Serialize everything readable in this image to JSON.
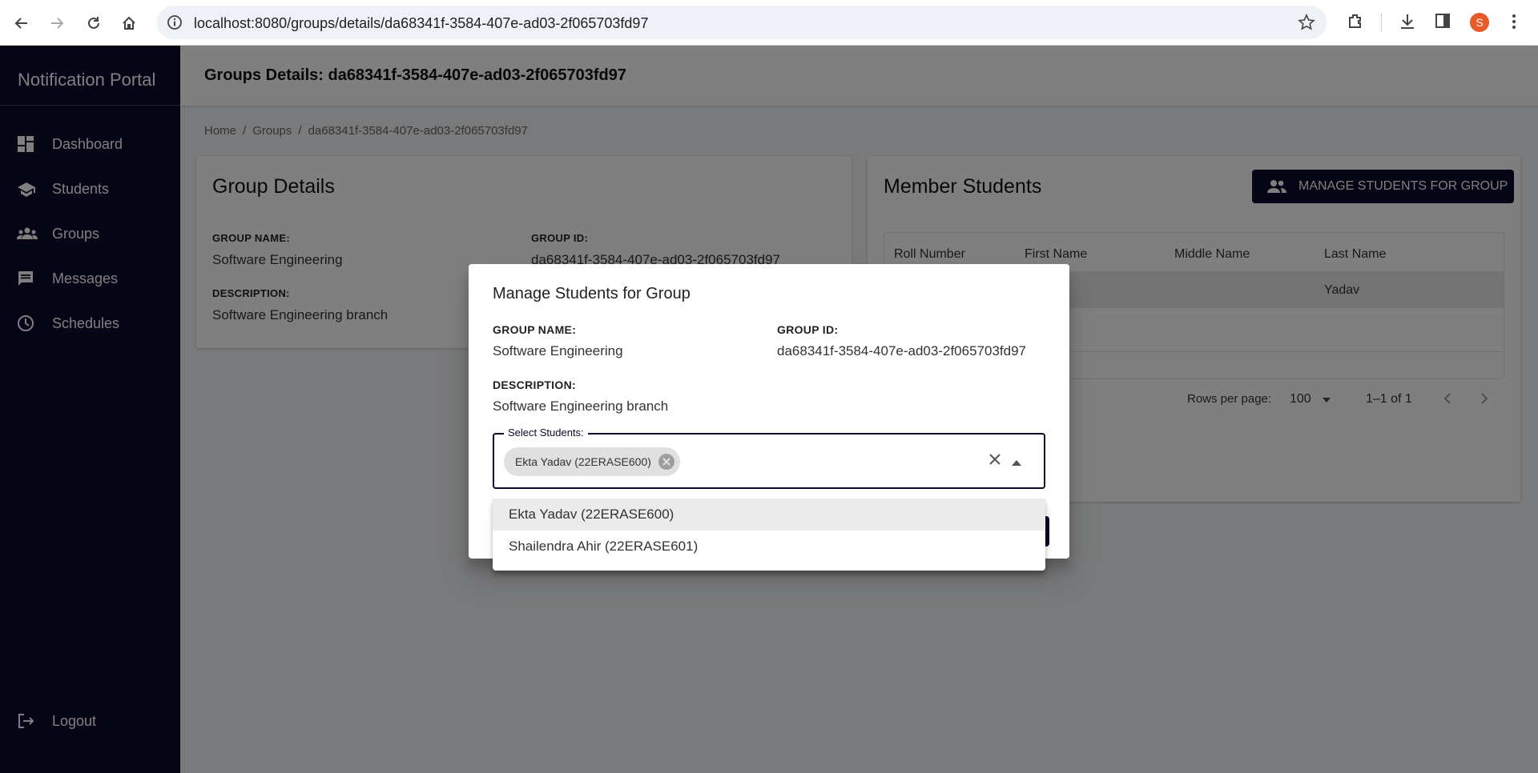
{
  "browser": {
    "url": "localhost:8080/groups/details/da68341f-3584-407e-ad03-2f065703fd97",
    "avatar_letter": "S"
  },
  "sidebar": {
    "brand": "Notification Portal",
    "items": [
      {
        "label": "Dashboard",
        "icon": "dashboard-icon"
      },
      {
        "label": "Students",
        "icon": "school-icon"
      },
      {
        "label": "Groups",
        "icon": "groups-icon"
      },
      {
        "label": "Messages",
        "icon": "message-icon"
      },
      {
        "label": "Schedules",
        "icon": "clock-icon"
      }
    ],
    "logout": "Logout"
  },
  "header": {
    "title": "Groups Details: da68341f-3584-407e-ad03-2f065703fd97"
  },
  "breadcrumb": [
    "Home",
    "Groups",
    "da68341f-3584-407e-ad03-2f065703fd97"
  ],
  "group_details": {
    "title": "Group Details",
    "name_label": "GROUP NAME:",
    "name_value": "Software Engineering",
    "id_label": "GROUP ID:",
    "id_value": "da68341f-3584-407e-ad03-2f065703fd97",
    "desc_label": "DESCRIPTION:",
    "desc_value": "Software Engineering branch"
  },
  "members": {
    "title": "Member Students",
    "manage_button": "MANAGE STUDENTS FOR GROUP",
    "columns": [
      "Roll Number",
      "First Name",
      "Middle Name",
      "Last Name"
    ],
    "rows": [
      {
        "roll": "",
        "first": "",
        "middle": "",
        "last": "Yadav"
      }
    ],
    "rows_per_page_label": "Rows per page:",
    "rows_per_page": "100",
    "range": "1–1 of 1"
  },
  "dialog": {
    "title": "Manage Students for Group",
    "name_label": "GROUP NAME:",
    "name_value": "Software Engineering",
    "id_label": "GROUP ID:",
    "id_value": "da68341f-3584-407e-ad03-2f065703fd97",
    "desc_label": "DESCRIPTION:",
    "desc_value": "Software Engineering branch",
    "select_label": "Select Students:",
    "selected_chip": "Ekta Yadav (22ERASE600)",
    "options": [
      "Ekta Yadav (22ERASE600)",
      "Shailendra Ahir (22ERASE601)"
    ]
  },
  "colors": {
    "sidebar": "#0a0a2a",
    "accent": "#0a0a2a",
    "avatar": "#ea5a28"
  }
}
